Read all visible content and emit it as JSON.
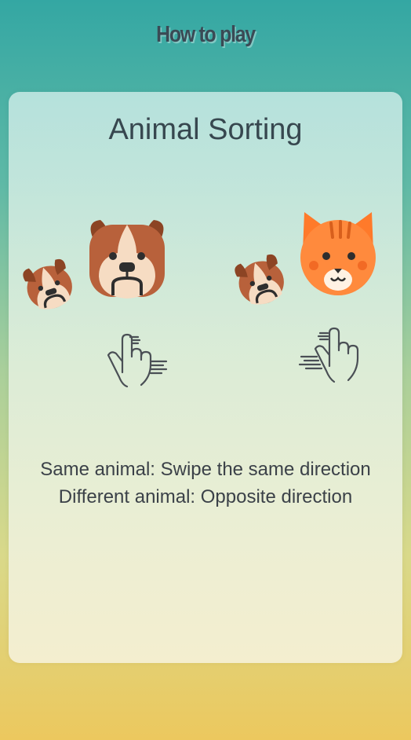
{
  "header": {
    "title": "How to play"
  },
  "card": {
    "title": "Animal Sorting",
    "instructions": {
      "line1": "Same animal: Swipe the same direction",
      "line2": "Different animal: Opposite direction"
    }
  },
  "icons": {
    "dog": "bulldog-icon",
    "cat": "cat-icon",
    "swipe_right": "swipe-right-hand-icon",
    "swipe_left": "swipe-left-hand-icon"
  },
  "colors": {
    "dog_brown": "#b8613b",
    "dog_cream": "#f6dcc3",
    "cat_orange": "#ff8a3d",
    "text": "#3b4148"
  }
}
